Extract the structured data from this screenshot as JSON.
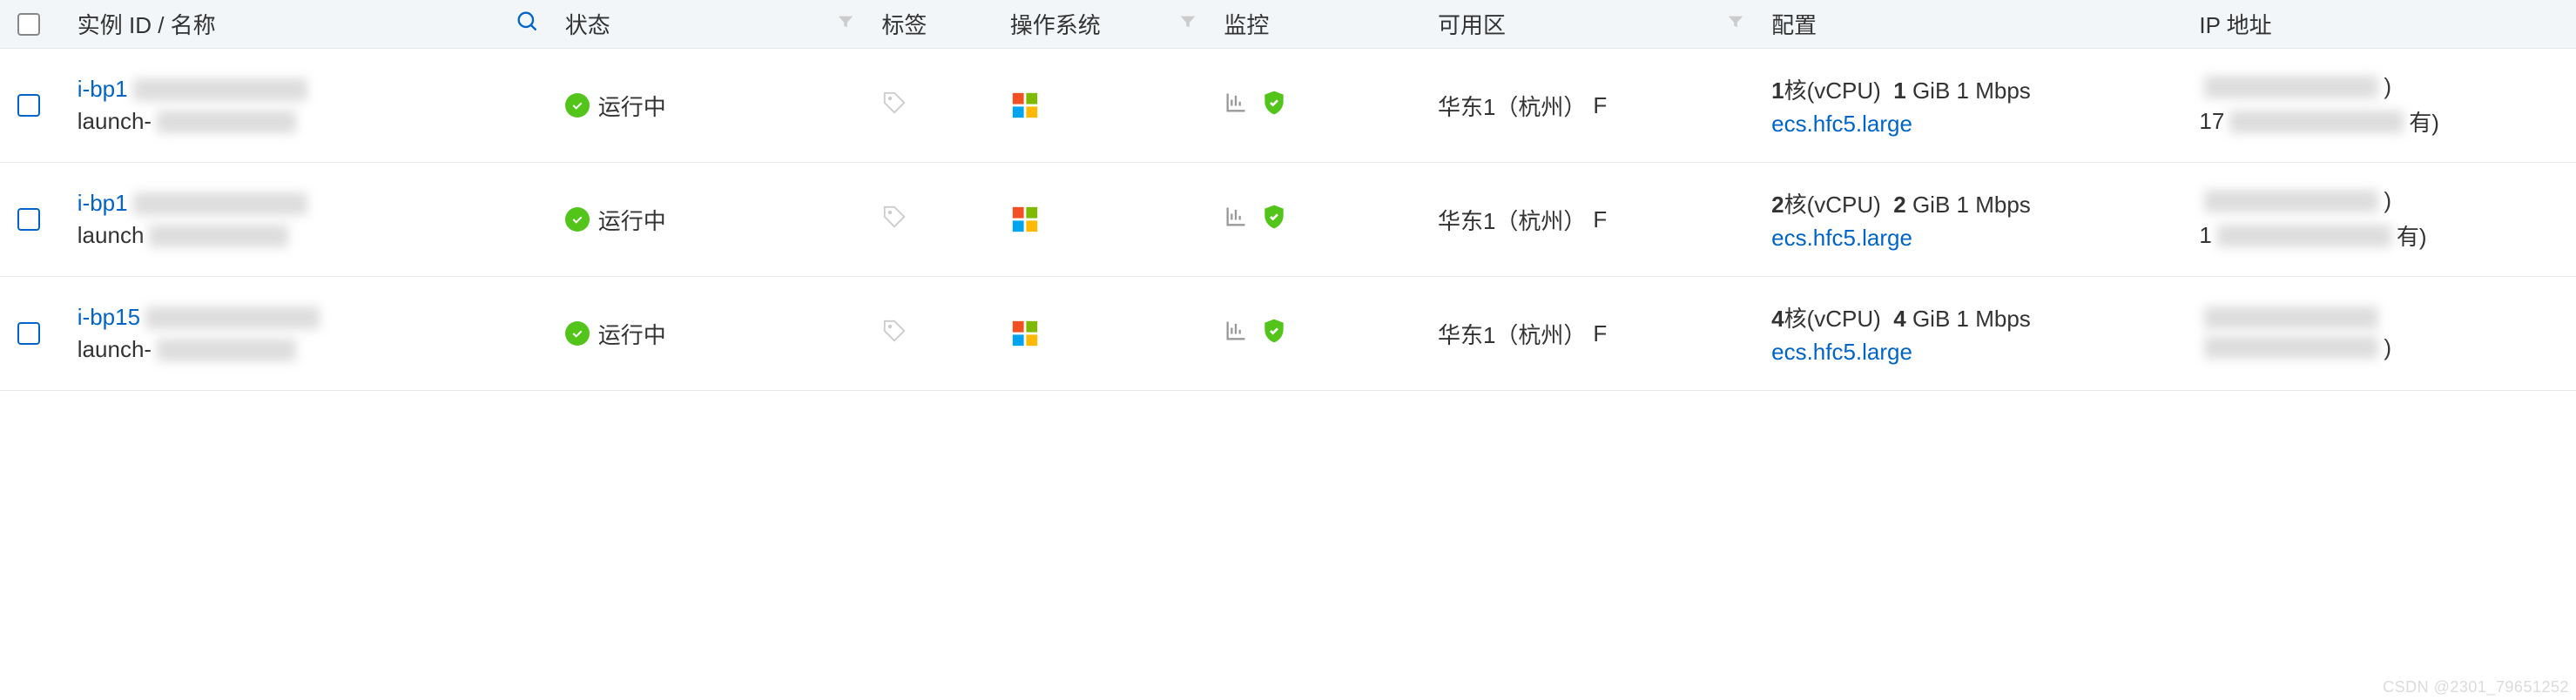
{
  "header": {
    "id_name": "实例 ID / 名称",
    "status": "状态",
    "tag": "标签",
    "os": "操作系统",
    "monitor": "监控",
    "zone": "可用区",
    "config": "配置",
    "ip": "IP 地址"
  },
  "rows": [
    {
      "id_prefix": "i-bp1",
      "name_prefix": "launch-",
      "status": "运行中",
      "zone": "华东1（杭州）",
      "zone_suffix": "F",
      "config_cpu_num": "1",
      "config_cpu_label": "核(vCPU)",
      "config_mem_num": "1",
      "config_mem_label": "GiB 1 Mbps",
      "config_type": "ecs.hfc5.large",
      "ip_prefix1": "",
      "ip_suffix1": ")",
      "ip_prefix2": "17",
      "ip_suffix2": "有)"
    },
    {
      "id_prefix": "i-bp1",
      "name_prefix": "launch",
      "status": "运行中",
      "zone": "华东1（杭州）",
      "zone_suffix": "F",
      "config_cpu_num": "2",
      "config_cpu_label": "核(vCPU)",
      "config_mem_num": "2",
      "config_mem_label": "GiB 1 Mbps",
      "config_type": "ecs.hfc5.large",
      "ip_prefix1": "",
      "ip_suffix1": ")",
      "ip_prefix2": "1",
      "ip_suffix2": "有)"
    },
    {
      "id_prefix": "i-bp15",
      "name_prefix": "launch-",
      "status": "运行中",
      "zone": "华东1（杭州）",
      "zone_suffix": "F",
      "config_cpu_num": "4",
      "config_cpu_label": "核(vCPU)",
      "config_mem_num": "4",
      "config_mem_label": "GiB 1 Mbps",
      "config_type": "ecs.hfc5.large",
      "ip_prefix1": "",
      "ip_suffix1": "",
      "ip_prefix2": "",
      "ip_suffix2": ")"
    }
  ],
  "watermark": "CSDN @2301_79651252"
}
